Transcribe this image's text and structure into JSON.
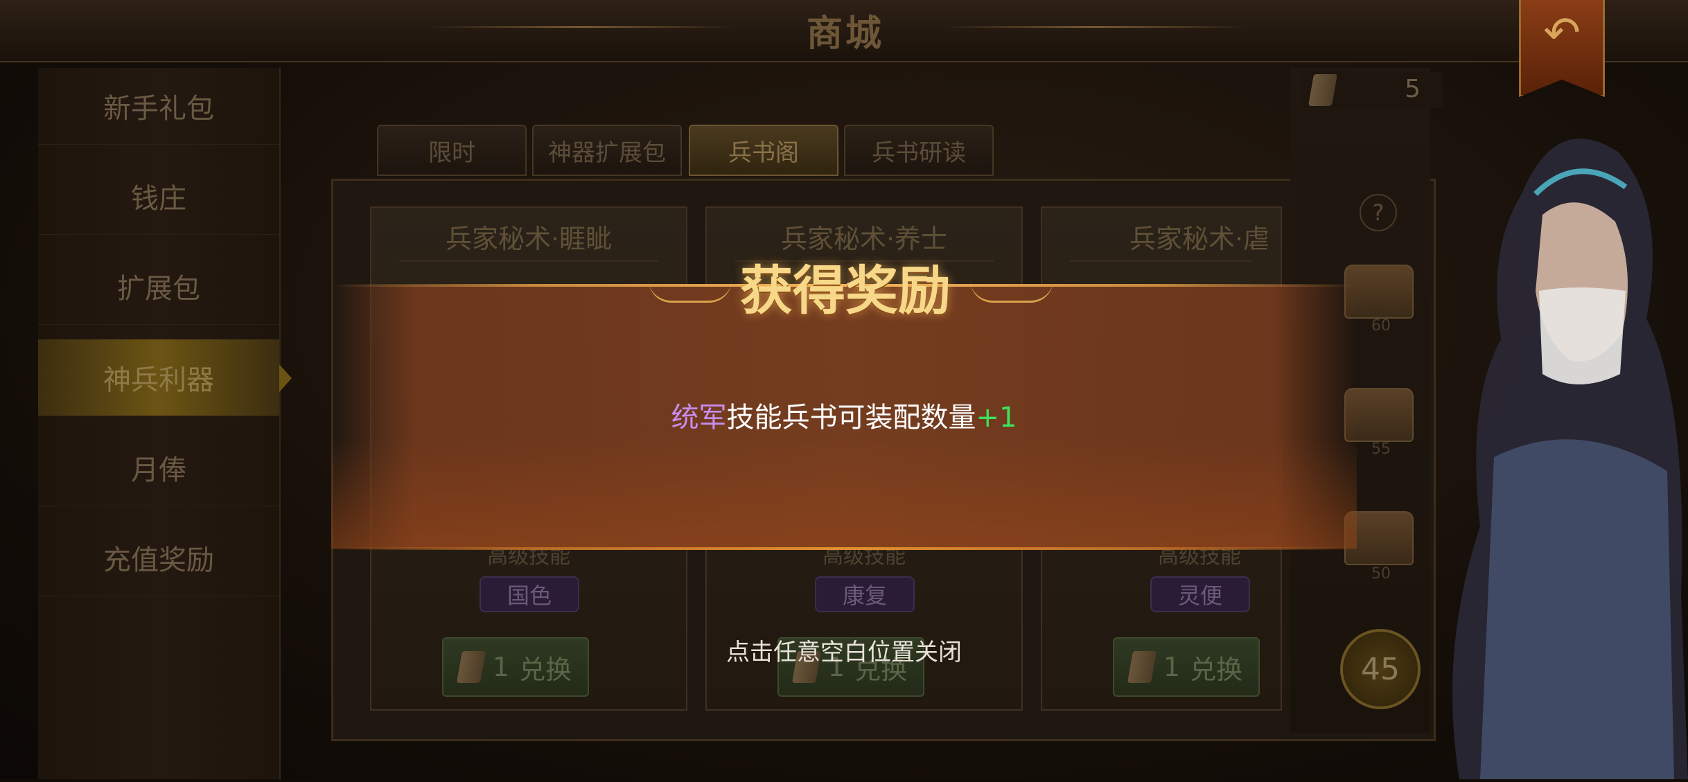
{
  "header": {
    "title": "商城"
  },
  "side_menu": {
    "items": [
      {
        "label": "新手礼包",
        "active": false
      },
      {
        "label": "钱庄",
        "active": false
      },
      {
        "label": "扩展包",
        "active": false
      },
      {
        "label": "神兵利器",
        "active": true
      },
      {
        "label": "月俸",
        "active": false
      },
      {
        "label": "充值奖励",
        "active": false
      }
    ]
  },
  "tabs": [
    {
      "label": "限时",
      "active": false
    },
    {
      "label": "神器扩展包",
      "active": false
    },
    {
      "label": "兵书阁",
      "active": true
    },
    {
      "label": "兵书研读",
      "active": false
    }
  ],
  "currency": {
    "value": "5"
  },
  "cards": [
    {
      "title": "兵家秘术·睚眦",
      "subtitle": "高级技能",
      "skill": "国色",
      "exchange_cost": "1",
      "exchange_label": "兑换"
    },
    {
      "title": "兵家秘术·养士",
      "subtitle": "高级技能",
      "skill": "康复",
      "exchange_cost": "1",
      "exchange_label": "兑换"
    },
    {
      "title": "兵家秘术·虐",
      "subtitle": "高级技能",
      "skill": "灵便",
      "exchange_cost": "1",
      "exchange_label": "兑换"
    }
  ],
  "right_rail": {
    "help": "?",
    "chests": [
      {
        "label": "60"
      },
      {
        "label": "55"
      },
      {
        "label": "50"
      }
    ],
    "progress": "45"
  },
  "reward_popup": {
    "title": "获得奖励",
    "stat_name": "统军",
    "message": "技能兵书可装配数量",
    "bonus": "+1",
    "close_hint": "点击任意空白位置关闭"
  },
  "colors": {
    "stat_purple": "#c98cf0",
    "bonus_green": "#3fe05a",
    "title_gold": "#f7d889"
  }
}
